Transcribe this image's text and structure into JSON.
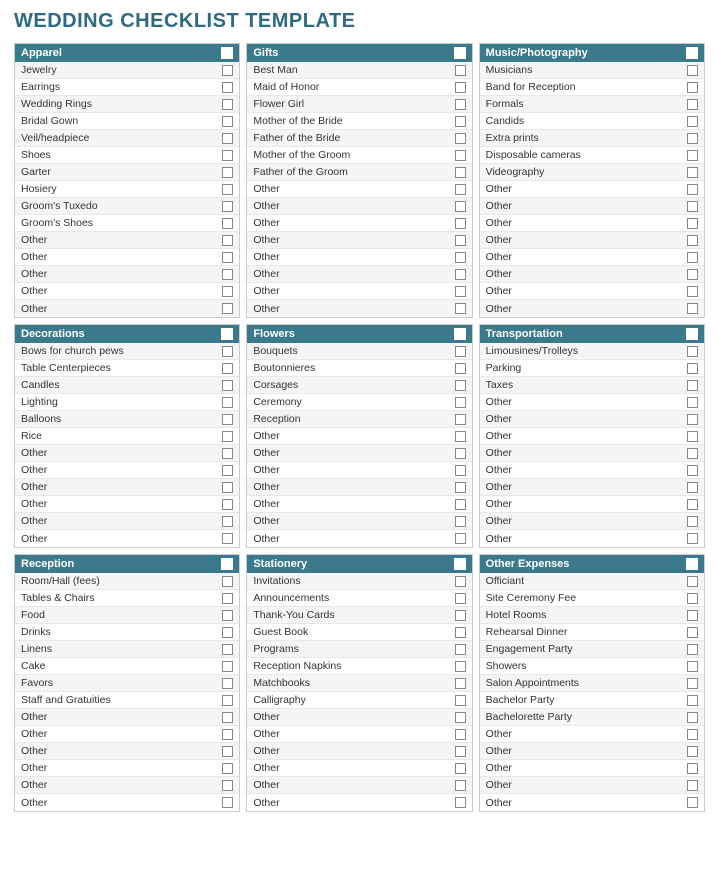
{
  "title": "WEDDING CHECKLIST TEMPLATE",
  "sections": [
    {
      "id": "apparel",
      "header": "Apparel",
      "rows": [
        "Jewelry",
        "Earrings",
        "Wedding Rings",
        "Bridal Gown",
        "Veil/headpiece",
        "Shoes",
        "Garter",
        "Hosiery",
        "Groom's Tuxedo",
        "Groom's Shoes",
        "Other",
        "Other",
        "Other",
        "Other",
        "Other"
      ]
    },
    {
      "id": "gifts",
      "header": "Gifts",
      "rows": [
        "Best Man",
        "Maid of Honor",
        "Flower Girl",
        "Mother of the Bride",
        "Father of the Bride",
        "Mother of the Groom",
        "Father of the Groom",
        "Other",
        "Other",
        "Other",
        "Other",
        "Other",
        "Other",
        "Other",
        "Other"
      ]
    },
    {
      "id": "music-photography",
      "header": "Music/Photography",
      "rows": [
        "Musicians",
        "Band for Reception",
        "Formals",
        "Candids",
        "Extra prints",
        "Disposable cameras",
        "Videography",
        "Other",
        "Other",
        "Other",
        "Other",
        "Other",
        "Other",
        "Other",
        "Other"
      ]
    },
    {
      "id": "decorations",
      "header": "Decorations",
      "rows": [
        "Bows for church pews",
        "Table Centerpieces",
        "Candles",
        "Lighting",
        "Balloons",
        "Rice",
        "Other",
        "Other",
        "Other",
        "Other",
        "Other",
        "Other"
      ]
    },
    {
      "id": "flowers",
      "header": "Flowers",
      "rows": [
        "Bouquets",
        "Boutonnieres",
        "Corsages",
        "Ceremony",
        "Reception",
        "Other",
        "Other",
        "Other",
        "Other",
        "Other",
        "Other",
        "Other"
      ]
    },
    {
      "id": "transportation",
      "header": "Transportation",
      "rows": [
        "Limousines/Trolleys",
        "Parking",
        "Taxes",
        "Other",
        "Other",
        "Other",
        "Other",
        "Other",
        "Other",
        "Other",
        "Other",
        "Other"
      ]
    },
    {
      "id": "reception",
      "header": "Reception",
      "rows": [
        "Room/Hall (fees)",
        "Tables & Chairs",
        "Food",
        "Drinks",
        "Linens",
        "Cake",
        "Favors",
        "Staff and Gratuities",
        "Other",
        "Other",
        "Other",
        "Other",
        "Other",
        "Other"
      ]
    },
    {
      "id": "stationery",
      "header": "Stationery",
      "rows": [
        "Invitations",
        "Announcements",
        "Thank-You Cards",
        "Guest Book",
        "Programs",
        "Reception Napkins",
        "Matchbooks",
        "Calligraphy",
        "Other",
        "Other",
        "Other",
        "Other",
        "Other",
        "Other"
      ]
    },
    {
      "id": "other-expenses",
      "header": "Other Expenses",
      "rows": [
        "Officiant",
        "Site Ceremony Fee",
        "Hotel Rooms",
        "Rehearsal Dinner",
        "Engagement Party",
        "Showers",
        "Salon Appointments",
        "Bachelor Party",
        "Bachelorette Party",
        "Other",
        "Other",
        "Other",
        "Other",
        "Other"
      ]
    }
  ]
}
